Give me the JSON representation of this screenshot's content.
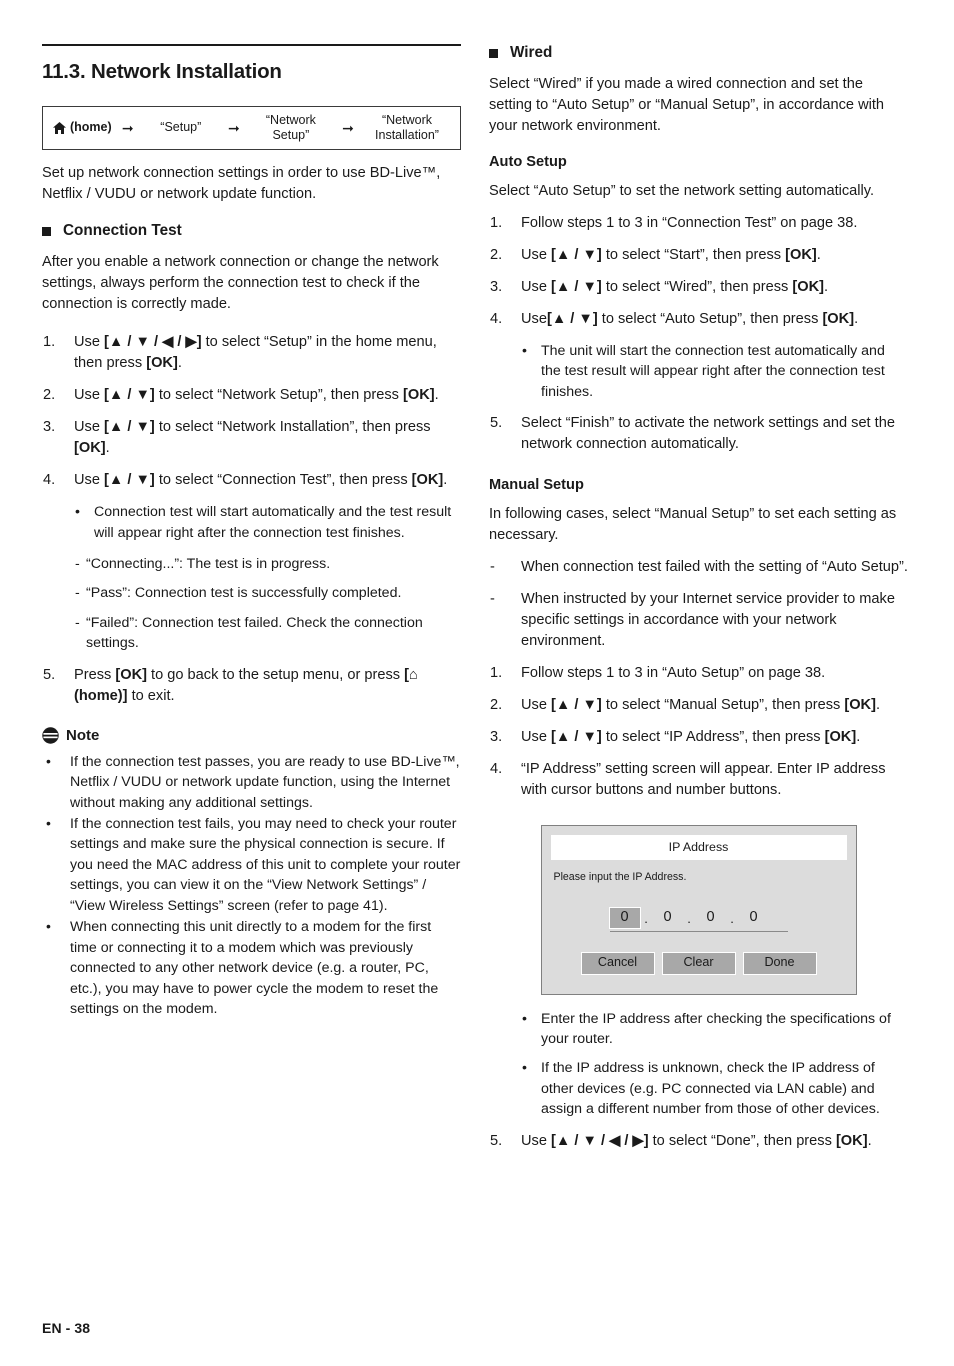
{
  "page": {
    "footer_label": "EN - 38"
  },
  "left": {
    "section_number_title": "11.3. Network Installation",
    "breadcrumb": {
      "home_label": "(home)",
      "home_icon": "home-icon",
      "arrow_icon": "arrow-right-icon",
      "step2": "“Setup”",
      "step3": "“Network Setup”",
      "step4": "“Network Installation”"
    },
    "intro": "Set up network connection settings in order to use BD-Live™, Netflix / VUDU or network update function.",
    "connection_test": {
      "heading": "Connection Test",
      "intro": "After you enable a network connection or change the network settings, always perform the connection test to check if the connection is correctly made.",
      "steps": [
        {
          "num": "1.",
          "parts": [
            {
              "t": "Use ",
              "b": false
            },
            {
              "t": "[▲ / ▼ / ◀ / ▶]",
              "b": true
            },
            {
              "t": " to select “Setup” in the home menu, then press ",
              "b": false
            },
            {
              "t": "[OK]",
              "b": true
            },
            {
              "t": ".",
              "b": false
            }
          ]
        },
        {
          "num": "2.",
          "parts": [
            {
              "t": "Use ",
              "b": false
            },
            {
              "t": "[▲ / ▼]",
              "b": true
            },
            {
              "t": " to select “Network Setup”, then press ",
              "b": false
            },
            {
              "t": "[OK]",
              "b": true
            },
            {
              "t": ".",
              "b": false
            }
          ]
        },
        {
          "num": "3.",
          "parts": [
            {
              "t": "Use ",
              "b": false
            },
            {
              "t": "[▲ / ▼]",
              "b": true
            },
            {
              "t": " to select “Network Installation”, then press ",
              "b": false
            },
            {
              "t": "[OK]",
              "b": true
            },
            {
              "t": ".",
              "b": false
            }
          ]
        },
        {
          "num": "4.",
          "parts": [
            {
              "t": "Use ",
              "b": false
            },
            {
              "t": "[▲ / ▼]",
              "b": true
            },
            {
              "t": " to select “Connection Test”, then press ",
              "b": false
            },
            {
              "t": "[OK]",
              "b": true
            },
            {
              "t": ".",
              "b": false
            }
          ]
        }
      ],
      "step4_bullets": [
        "Connection test will start automatically and the test result will appear right after the connection test finishes."
      ],
      "step4_dashes": [
        "“Connecting...”: The test is in progress.",
        "“Pass”: Connection test is successfully completed.",
        "“Failed”: Connection test failed. Check the connection settings."
      ],
      "step5": {
        "num": "5.",
        "parts": [
          {
            "t": "Press ",
            "b": false
          },
          {
            "t": "[OK]",
            "b": true
          },
          {
            "t": " to go back to the setup menu, or press ",
            "b": false
          },
          {
            "t": "[⌂ (home)]",
            "b": true
          },
          {
            "t": " to exit.",
            "b": false
          }
        ]
      }
    },
    "note": {
      "icon": "note-icon",
      "title": "Note",
      "items": [
        "If the connection test passes, you are ready to use BD-Live™, Netflix / VUDU or network update function, using the Internet without making any additional settings.",
        "If the connection test fails, you may need to check your router settings and make sure the physical connection is secure. If you need the MAC address of this unit to complete your router settings, you can view it on the “View Network Settings” / “View Wireless Settings” screen (refer to page 41).",
        "When connecting this unit directly to a modem for the first time or connecting it to a modem which was previously connected to any other network device (e.g. a router, PC, etc.), you may have to power cycle the modem to reset the settings on the modem."
      ]
    }
  },
  "right": {
    "wired": {
      "heading": "Wired",
      "intro": "Select “Wired” if you made a wired connection and set the setting to “Auto Setup” or “Manual Setup”, in accordance with your network environment."
    },
    "auto_setup": {
      "heading": "Auto Setup",
      "intro": "Select “Auto Setup” to set the network setting automatically.",
      "steps": [
        {
          "num": "1.",
          "parts": [
            {
              "t": "Follow steps 1 to 3 in “Connection Test” on page 38.",
              "b": false
            }
          ]
        },
        {
          "num": "2.",
          "parts": [
            {
              "t": "Use ",
              "b": false
            },
            {
              "t": "[▲ / ▼]",
              "b": true
            },
            {
              "t": " to select “Start”, then press ",
              "b": false
            },
            {
              "t": "[OK]",
              "b": true
            },
            {
              "t": ".",
              "b": false
            }
          ]
        },
        {
          "num": "3.",
          "parts": [
            {
              "t": "Use ",
              "b": false
            },
            {
              "t": "[▲ / ▼]",
              "b": true
            },
            {
              "t": " to select “Wired”, then press ",
              "b": false
            },
            {
              "t": "[OK]",
              "b": true
            },
            {
              "t": ".",
              "b": false
            }
          ]
        },
        {
          "num": "4.",
          "parts": [
            {
              "t": "Use",
              "b": false
            },
            {
              "t": "[▲ / ▼]",
              "b": true
            },
            {
              "t": " to select “Auto Setup”, then press ",
              "b": false
            },
            {
              "t": "[OK]",
              "b": true
            },
            {
              "t": ".",
              "b": false
            }
          ]
        }
      ],
      "step4_bullets": [
        "The unit will start the connection test automatically and the test result will appear right after the connection test finishes."
      ],
      "step5": {
        "num": "5.",
        "parts": [
          {
            "t": "Select “Finish” to activate the network settings and set the network connection automatically.",
            "b": false
          }
        ]
      }
    },
    "manual_setup": {
      "heading": "Manual Setup",
      "intro": "In following cases, select “Manual Setup” to set each setting as necessary.",
      "dashes": [
        "When connection test failed with the setting of “Auto Setup”.",
        "When instructed by your Internet service provider to make specific settings in accordance with your network environment."
      ],
      "steps": [
        {
          "num": "1.",
          "parts": [
            {
              "t": "Follow steps 1 to 3 in “Auto Setup” on page 38.",
              "b": false
            }
          ]
        },
        {
          "num": "2.",
          "parts": [
            {
              "t": "Use ",
              "b": false
            },
            {
              "t": "[▲ / ▼]",
              "b": true
            },
            {
              "t": " to select “Manual Setup”, then press ",
              "b": false
            },
            {
              "t": "[OK]",
              "b": true
            },
            {
              "t": ".",
              "b": false
            }
          ]
        },
        {
          "num": "3.",
          "parts": [
            {
              "t": "Use ",
              "b": false
            },
            {
              "t": "[▲ / ▼]",
              "b": true
            },
            {
              "t": " to select “IP Address”, then press ",
              "b": false
            },
            {
              "t": "[OK]",
              "b": true
            },
            {
              "t": ".",
              "b": false
            }
          ]
        },
        {
          "num": "4.",
          "parts": [
            {
              "t": "“IP Address” setting screen will appear. Enter IP address with cursor buttons and number buttons.",
              "b": false
            }
          ]
        }
      ],
      "after_dialog_bullets": [
        "Enter the IP address after checking the specifications of your router.",
        "If the IP address is unknown, check the IP address of other devices (e.g. PC connected via LAN cable) and assign a different number from those of other devices."
      ],
      "step5": {
        "num": "5.",
        "parts": [
          {
            "t": "Use ",
            "b": false
          },
          {
            "t": "[▲ / ▼ / ◀ / ▶]",
            "b": true
          },
          {
            "t": " to select “Done”, then press ",
            "b": false
          },
          {
            "t": "[OK]",
            "b": true
          },
          {
            "t": ".",
            "b": false
          }
        ]
      }
    },
    "ip_dialog": {
      "title": "IP Address",
      "prompt": "Please input the IP Address.",
      "octets": [
        "0",
        "0",
        "0",
        "0"
      ],
      "selected_octet_index": 0,
      "separator": ".",
      "buttons": [
        "Cancel",
        "Clear",
        "Done"
      ],
      "colors": {
        "panel_bg": "#dcdcdc",
        "title_bg": "#ffffff",
        "button_bg": "#a8a8a8",
        "selection_bg": "#a8a8a8",
        "border": "#808080"
      }
    }
  }
}
